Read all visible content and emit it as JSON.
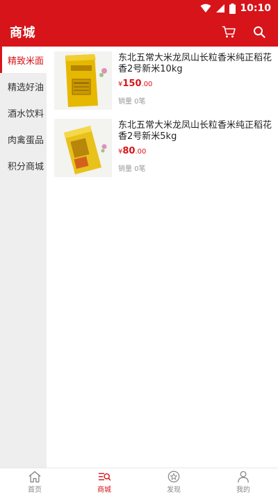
{
  "status_bar": {
    "time": "10:10",
    "wifi_icon": "wifi-icon",
    "signal_icon": "signal-icon",
    "battery_icon": "battery-icon"
  },
  "app_bar": {
    "title": "商城",
    "cart_icon": "cart-icon",
    "search_icon": "search-icon"
  },
  "colors": {
    "brand": "#d6141a",
    "sidebar_bg": "#eeeeee",
    "muted_text": "#999999"
  },
  "sidebar": {
    "items": [
      {
        "label": "精致米面",
        "active": true
      },
      {
        "label": "精选好油",
        "active": false
      },
      {
        "label": "酒水饮料",
        "active": false
      },
      {
        "label": "肉禽蛋品",
        "active": false
      },
      {
        "label": "积分商城",
        "active": false
      }
    ]
  },
  "products": [
    {
      "title": "东北五常大米龙凤山长粒香米纯正稻花香2号新米10kg",
      "currency": "¥",
      "price_int": "150",
      "price_dec": ".00",
      "sales": "销量 0笔"
    },
    {
      "title": "东北五常大米龙凤山长粒香米纯正稻花香2号新米5kg",
      "currency": "¥",
      "price_int": "80",
      "price_dec": ".00",
      "sales": "销量 0笔"
    }
  ],
  "bottom_nav": {
    "items": [
      {
        "label": "首页",
        "icon": "home-icon",
        "active": false
      },
      {
        "label": "商城",
        "icon": "shop-icon",
        "active": true
      },
      {
        "label": "发现",
        "icon": "discover-icon",
        "active": false
      },
      {
        "label": "我的",
        "icon": "profile-icon",
        "active": false
      }
    ]
  }
}
